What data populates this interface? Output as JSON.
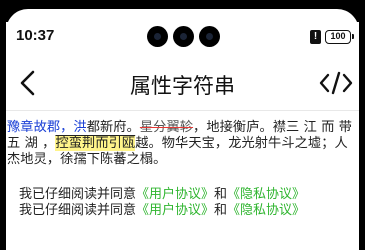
{
  "status_bar": {
    "time": "10:37",
    "alert_icon": "!",
    "battery": "100"
  },
  "nav": {
    "title": "属性字符串",
    "back_icon": "chevron-left-icon",
    "code_icon": "code-icon"
  },
  "rich_text": {
    "seg_blue": "豫章故郡，洪",
    "seg_plain_1": "都新府。",
    "seg_strike": "星分翼轸",
    "seg_plain_2": "，地接衡庐。襟三 江 而 带 五 湖 ，",
    "seg_highlight": "控蛮荆而引瓯",
    "seg_plain_3": "越。物华天宝，龙光射牛斗之墟；人杰地灵，徐孺下陈蕃之榻。",
    "colors": {
      "blue": "#1a3fd6",
      "strike": "#e53935",
      "highlight": "#fff48a"
    }
  },
  "agreements": [
    {
      "prefix": "我已仔细阅读并同意",
      "link1": "《用户协议》",
      "conj": "和",
      "link2": "《隐私协议》"
    },
    {
      "prefix": "我已仔细阅读并同意",
      "link1": "《用户协议》",
      "conj": "和",
      "link2": "《隐私协议》"
    }
  ],
  "link_color": "#2fb52f"
}
